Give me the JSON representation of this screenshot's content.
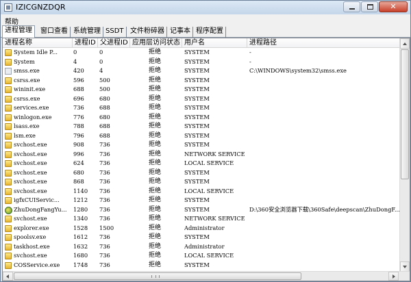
{
  "window": {
    "title": "IZICGNZDQR"
  },
  "menu": {
    "items": [
      "帮助"
    ]
  },
  "tabs": [
    {
      "label": "进程管理",
      "active": true
    },
    {
      "label": "窗口查看",
      "active": false
    },
    {
      "label": "系统管理",
      "active": false
    },
    {
      "label": "SSDT",
      "active": false
    },
    {
      "label": "文件粉碎器",
      "active": false
    },
    {
      "label": "记事本",
      "active": false
    },
    {
      "label": "程序配置",
      "active": false
    }
  ],
  "table": {
    "columns": [
      "进程名称",
      "进程ID",
      "父进程ID",
      "应用层访问状态",
      "用户名",
      "进程路径"
    ],
    "rows": [
      {
        "icon": "folder-icon",
        "name": "System Idle P...",
        "pid": "0",
        "ppid": "0",
        "access": "拒绝",
        "user": "SYSTEM",
        "path": "-"
      },
      {
        "icon": "folder-icon",
        "name": "System",
        "pid": "4",
        "ppid": "0",
        "access": "拒绝",
        "user": "SYSTEM",
        "path": "-"
      },
      {
        "icon": "exe-icon",
        "name": "smss.exe",
        "pid": "420",
        "ppid": "4",
        "access": "拒绝",
        "user": "SYSTEM",
        "path": "C:\\WINDOWS\\system32\\smss.exe"
      },
      {
        "icon": "folder-icon",
        "name": "csrss.exe",
        "pid": "596",
        "ppid": "500",
        "access": "拒绝",
        "user": "SYSTEM",
        "path": ""
      },
      {
        "icon": "folder-icon",
        "name": "wininit.exe",
        "pid": "688",
        "ppid": "500",
        "access": "拒绝",
        "user": "SYSTEM",
        "path": ""
      },
      {
        "icon": "folder-icon",
        "name": "csrss.exe",
        "pid": "696",
        "ppid": "680",
        "access": "拒绝",
        "user": "SYSTEM",
        "path": ""
      },
      {
        "icon": "folder-icon",
        "name": "services.exe",
        "pid": "736",
        "ppid": "688",
        "access": "拒绝",
        "user": "SYSTEM",
        "path": ""
      },
      {
        "icon": "folder-icon",
        "name": "winlogon.exe",
        "pid": "776",
        "ppid": "680",
        "access": "拒绝",
        "user": "SYSTEM",
        "path": ""
      },
      {
        "icon": "folder-icon",
        "name": "lsass.exe",
        "pid": "788",
        "ppid": "688",
        "access": "拒绝",
        "user": "SYSTEM",
        "path": ""
      },
      {
        "icon": "folder-icon",
        "name": "lsm.exe",
        "pid": "796",
        "ppid": "688",
        "access": "拒绝",
        "user": "SYSTEM",
        "path": ""
      },
      {
        "icon": "folder-icon",
        "name": "svchost.exe",
        "pid": "908",
        "ppid": "736",
        "access": "拒绝",
        "user": "SYSTEM",
        "path": ""
      },
      {
        "icon": "folder-icon",
        "name": "svchost.exe",
        "pid": "996",
        "ppid": "736",
        "access": "拒绝",
        "user": "NETWORK SERVICE",
        "path": ""
      },
      {
        "icon": "folder-icon",
        "name": "svchost.exe",
        "pid": "624",
        "ppid": "736",
        "access": "拒绝",
        "user": "LOCAL SERVICE",
        "path": ""
      },
      {
        "icon": "folder-icon",
        "name": "svchost.exe",
        "pid": "680",
        "ppid": "736",
        "access": "拒绝",
        "user": "SYSTEM",
        "path": ""
      },
      {
        "icon": "folder-icon",
        "name": "svchost.exe",
        "pid": "868",
        "ppid": "736",
        "access": "拒绝",
        "user": "SYSTEM",
        "path": ""
      },
      {
        "icon": "folder-icon",
        "name": "svchost.exe",
        "pid": "1140",
        "ppid": "736",
        "access": "拒绝",
        "user": "LOCAL SERVICE",
        "path": ""
      },
      {
        "icon": "folder-icon",
        "name": "igfxCUIServic...",
        "pid": "1212",
        "ppid": "736",
        "access": "拒绝",
        "user": "SYSTEM",
        "path": ""
      },
      {
        "icon": "zhudongfangyu-icon",
        "name": "ZhuDongFangYu...",
        "pid": "1280",
        "ppid": "736",
        "access": "拒绝",
        "user": "SYSTEM",
        "path": "D:\\360安全浏览器下载\\360Safe\\deepscan\\ZhuDongF..."
      },
      {
        "icon": "folder-icon",
        "name": "svchost.exe",
        "pid": "1340",
        "ppid": "736",
        "access": "拒绝",
        "user": "NETWORK SERVICE",
        "path": ""
      },
      {
        "icon": "folder-icon",
        "name": "explorer.exe",
        "pid": "1528",
        "ppid": "1500",
        "access": "拒绝",
        "user": "Administrator",
        "path": ""
      },
      {
        "icon": "folder-icon",
        "name": "spoolsv.exe",
        "pid": "1612",
        "ppid": "736",
        "access": "拒绝",
        "user": "SYSTEM",
        "path": ""
      },
      {
        "icon": "folder-icon",
        "name": "taskhost.exe",
        "pid": "1632",
        "ppid": "736",
        "access": "拒绝",
        "user": "Administrator",
        "path": ""
      },
      {
        "icon": "folder-icon",
        "name": "svchost.exe",
        "pid": "1680",
        "ppid": "736",
        "access": "拒绝",
        "user": "LOCAL SERVICE",
        "path": ""
      },
      {
        "icon": "folder-icon",
        "name": "COSService.exe",
        "pid": "1748",
        "ppid": "736",
        "access": "拒绝",
        "user": "SYSTEM",
        "path": ""
      }
    ]
  }
}
